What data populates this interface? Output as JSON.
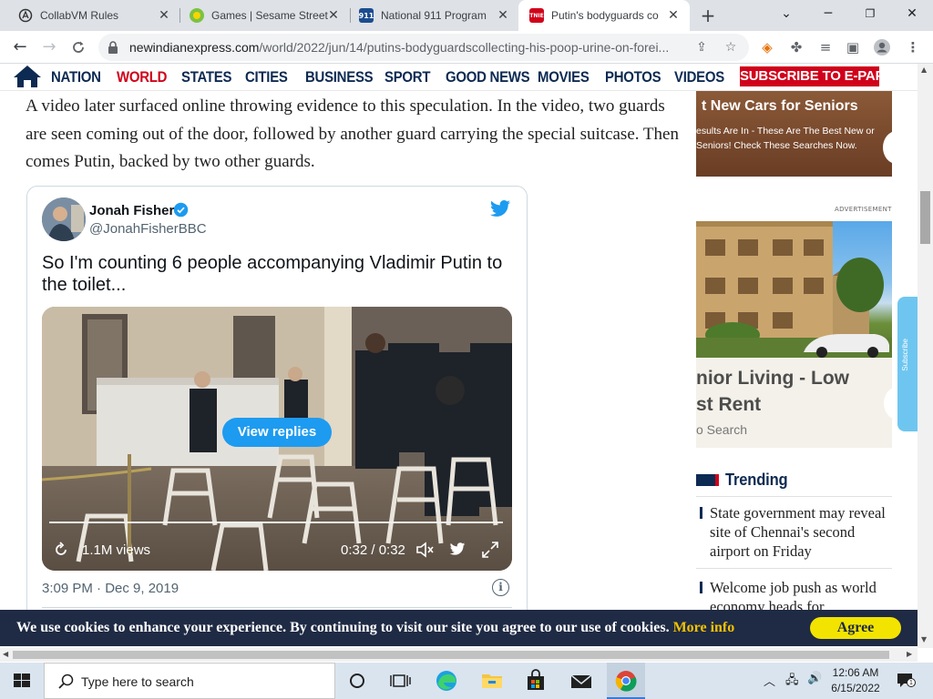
{
  "tabs": [
    {
      "title": "CollabVM Rules",
      "favicon": "collabvm-icon"
    },
    {
      "title": "Games | Sesame Street",
      "favicon": "sesame-street-icon"
    },
    {
      "title": "National 911 Program",
      "favicon": "911-icon"
    },
    {
      "title": "Putin's bodyguards co",
      "favicon": "tnie-icon",
      "active": true
    }
  ],
  "favicon_text": {
    "n911": "911",
    "tnie": "TNIE"
  },
  "address": {
    "domain": "newindianexpress.com",
    "path": "/world/2022/jun/14/putins-bodyguardscollecting-his-poop-urine-on-forei..."
  },
  "site_nav": [
    "NATION",
    "WORLD",
    "STATES",
    "CITIES",
    "BUSINESS",
    "SPORT",
    "GOOD NEWS",
    "MOVIES",
    "PHOTOS",
    "VIDEOS"
  ],
  "subscribe_label": "SUBSCRIBE TO E-PAPER",
  "article_text": "A video later surfaced online throwing evidence to this speculation. In the video, two guards are seen coming out of the door, followed by another guard carrying the special suitcase. Then comes Putin, backed by two other guards.",
  "tweet": {
    "name": "Jonah Fisher",
    "handle": "@JonahFisherBBC",
    "text": "So I'm counting 6 people accompanying Vladimir Putin to the toilet...",
    "view_replies": "View replies",
    "views": "1.1M views",
    "duration": "0:32 / 0:32",
    "timestamp": "3:09 PM · Dec 9, 2019",
    "info_glyph": "i"
  },
  "sidebar": {
    "ad1": {
      "headline": "t New Cars for Seniors",
      "body": "esults Are In - These Are The Best New or Seniors! Check These Searches Now."
    },
    "ad_label": "ADVERTISEMENT",
    "ad2": {
      "headline_line1": "nior Living - Low",
      "headline_line2": "st Rent",
      "source": "o Search"
    },
    "side_tab_text": "Subscribe",
    "trending_label": "Trending",
    "trending": [
      {
        "text": "State government may reveal site of Chennai's second airport on Friday"
      },
      {
        "text": "Welcome job push as world economy heads for"
      }
    ]
  },
  "cookie": {
    "message": "We use cookies to enhance your experience. By continuing to visit our site you agree to our use of cookies.",
    "more_info": "More info",
    "agree": "Agree"
  },
  "taskbar": {
    "search_placeholder": "Type here to search",
    "time": "12:06 AM",
    "date": "6/15/2022",
    "notification_count": "1"
  },
  "colors": {
    "nav_blue": "#0d2a52",
    "brand_red": "#d0021b",
    "twitter_blue": "#1d9bf0",
    "cookie_bg": "#1f2a44",
    "agree_yellow": "#f2e400"
  }
}
